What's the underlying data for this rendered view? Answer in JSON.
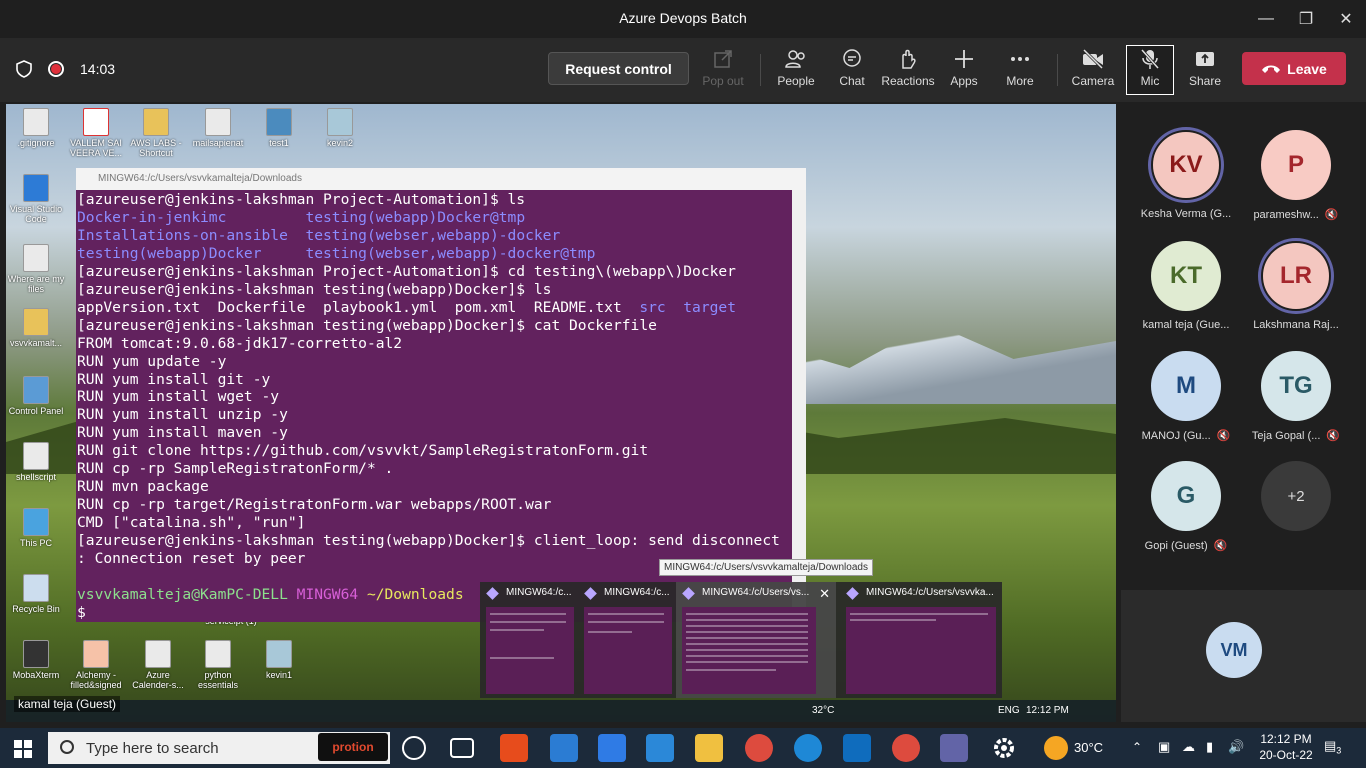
{
  "window": {
    "title": "Azure Devops Batch"
  },
  "meeting": {
    "timer": "14:03",
    "request_control": "Request control",
    "tools": {
      "popout": "Pop out",
      "people": "People",
      "chat": "Chat",
      "reactions": "Reactions",
      "apps": "Apps",
      "more": "More",
      "camera": "Camera",
      "mic": "Mic",
      "share": "Share"
    },
    "leave": "Leave"
  },
  "desktop_icons": [
    {
      "label": ".gitignore"
    },
    {
      "label": "VALLEM SAI VEERA VE..."
    },
    {
      "label": "AWS LABS - Shortcut"
    },
    {
      "label": "mailsapienat"
    },
    {
      "label": "test1"
    },
    {
      "label": "kevin2"
    },
    {
      "label": "Visual Studio Code"
    },
    {
      "label": "Where are my files"
    },
    {
      "label": "vsvvkamalt..."
    },
    {
      "label": "Control Panel"
    },
    {
      "label": "shellscript"
    },
    {
      "label": "This PC"
    },
    {
      "label": "Recycle Bin"
    },
    {
      "label": "MobaXterm"
    },
    {
      "label": "Alchemy - filled&signed"
    },
    {
      "label": "Azure Calender-s..."
    },
    {
      "label": "python essentials"
    },
    {
      "label": "kevin1"
    }
  ],
  "terminal": {
    "title": "MINGW64:/c/Users/vsvvkamalteja/Downloads",
    "lines": {
      "l1": "[azureuser@jenkins-lakshman Project-Automation]$ ls",
      "l2a": "Docker-in-jenkimc         ",
      "l2b": "testing(webapp)Docker@tmp",
      "l3a": "Installations-on-ansible  ",
      "l3b": "testing(webser,webapp)-docker",
      "l4a": "testing(webapp)Docker     ",
      "l4b": "testing(webser,webapp)-docker@tmp",
      "l5": "[azureuser@jenkins-lakshman Project-Automation]$ cd testing\\(webapp\\)Docker",
      "l6": "[azureuser@jenkins-lakshman testing(webapp)Docker]$ ls",
      "l7a": "appVersion.txt  Dockerfile  playbook1.yml  pom.xml  README.txt  ",
      "l7b": "src  target",
      "l8": "[azureuser@jenkins-lakshman testing(webapp)Docker]$ cat Dockerfile",
      "l9": "FROM tomcat:9.0.68-jdk17-corretto-al2",
      "l10": "RUN yum update -y",
      "l11": "RUN yum install git -y",
      "l12": "RUN yum install wget -y",
      "l13": "RUN yum install unzip -y",
      "l14": "RUN yum install maven -y",
      "l15": "RUN git clone https://github.com/vsvvkt/SampleRegistratonForm.git",
      "l16": "RUN cp -rp SampleRegistratonForm/* .",
      "l17": "RUN mvn package",
      "l18": "RUN cp -rp target/RegistratonForm.war webapps/ROOT.war",
      "l19": "CMD [\"catalina.sh\", \"run\"]",
      "l20": "[azureuser@jenkins-lakshman testing(webapp)Docker]$ client_loop: send disconnect",
      "l21": ": Connection reset by peer",
      "l22": "",
      "l23a": "vsvvkamalteja@KamPC-DELL ",
      "l23b": "MINGW64 ",
      "l23c": "~/Downloads",
      "l24": "$ "
    }
  },
  "tooltip": "MINGW64:/c/Users/vsvvkamalteja/Downloads",
  "thumbnails": [
    {
      "title": "MINGW64:/c..."
    },
    {
      "title": "MINGW64:/c..."
    },
    {
      "title": "MINGW64:/c/Users/vs..."
    },
    {
      "title": "MINGW64:/c/Users/vsvvka..."
    }
  ],
  "inner_tray": {
    "temp": "32°C",
    "lang": "ENG",
    "time": "12:12 PM",
    "stray": "serviceipt (1)"
  },
  "guest_label": "kamal teja (Guest)",
  "participants": [
    {
      "initials": "KV",
      "name": "Kesha Verma (G...",
      "bg": "#f4c7c0",
      "fg": "#8b1a1a",
      "speaking": true,
      "muted": false
    },
    {
      "initials": "P",
      "name": "parameshw...",
      "bg": "#f8cbc4",
      "fg": "#a4262c",
      "speaking": false,
      "muted": true
    },
    {
      "initials": "KT",
      "name": "kamal teja (Gue...",
      "bg": "#e0ebd2",
      "fg": "#4a6a2a",
      "speaking": false,
      "muted": false
    },
    {
      "initials": "LR",
      "name": "Lakshmana Raj...",
      "bg": "#f4c7c0",
      "fg": "#a4262c",
      "speaking": true,
      "muted": false
    },
    {
      "initials": "M",
      "name": "MANOJ (Gu...",
      "bg": "#c9dcf0",
      "fg": "#1e4a80",
      "speaking": false,
      "muted": true
    },
    {
      "initials": "TG",
      "name": "Teja Gopal (...",
      "bg": "#d5e6ea",
      "fg": "#2a5a66",
      "speaking": false,
      "muted": true
    },
    {
      "initials": "G",
      "name": "Gopi (Guest)",
      "bg": "#d5e6ea",
      "fg": "#2a5a66",
      "speaking": false,
      "muted": true
    }
  ],
  "overflow": "+2",
  "self": {
    "initials": "VM"
  },
  "taskbar": {
    "search_placeholder": "Type here to search",
    "protion": "protion",
    "weather": "30°C",
    "time": "12:12 PM",
    "date": "20-Oct-22",
    "notif_count": "3"
  }
}
